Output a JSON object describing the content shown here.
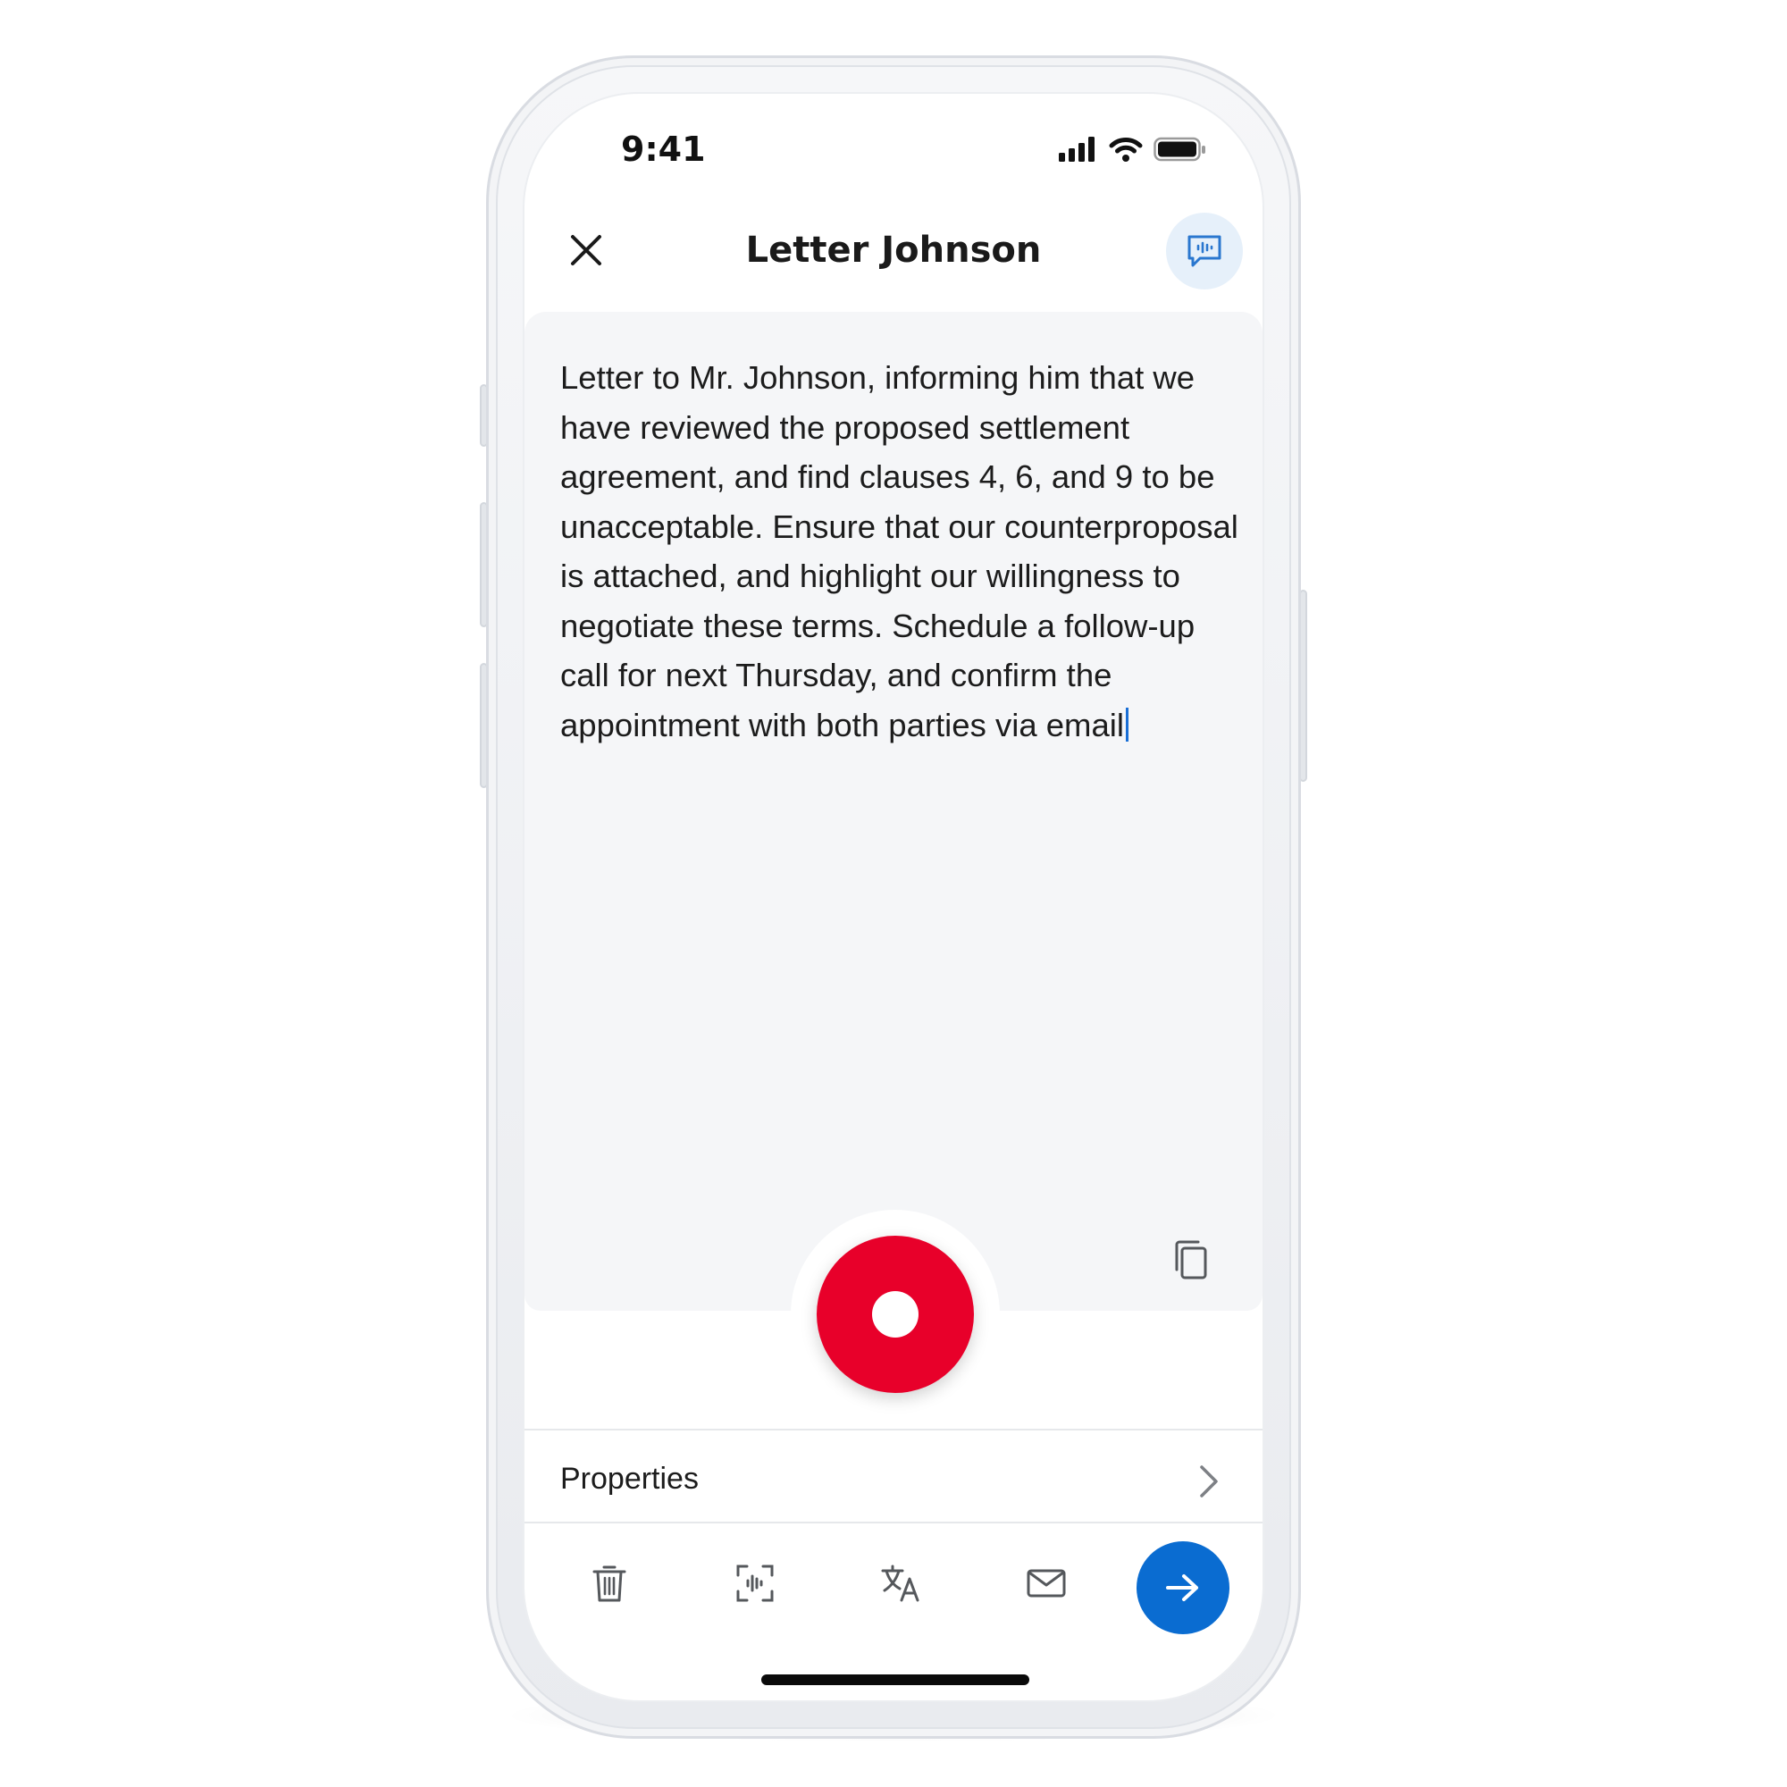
{
  "status_bar": {
    "time": "9:41"
  },
  "header": {
    "title": "Letter Johnson"
  },
  "dictation": {
    "text": "Letter to Mr. Johnson, informing him that we have reviewed the proposed settlement agreement, and find clauses 4, 6, and 9 to be unacceptable. Ensure that our counterproposal is attached, and highlight our willingness to negotiate these terms. Schedule a follow-up call for next Thursday, and confirm the appointment with both parties via email"
  },
  "properties": {
    "label": "Properties"
  },
  "icons": {
    "close": "close-icon",
    "speech": "speech-bubble-icon",
    "copy": "copy-icon",
    "record": "record-icon",
    "chevron": "chevron-right-icon",
    "delete": "trash-icon",
    "scan": "voice-scan-icon",
    "translate": "translate-icon",
    "email": "mail-icon",
    "send": "arrow-right-icon"
  },
  "colors": {
    "record": "#e8002a",
    "accent": "#0a6cd1",
    "card_bg": "#f5f6f8",
    "speech_bg": "#e6f0fa",
    "cursor": "#1a6fd6"
  }
}
